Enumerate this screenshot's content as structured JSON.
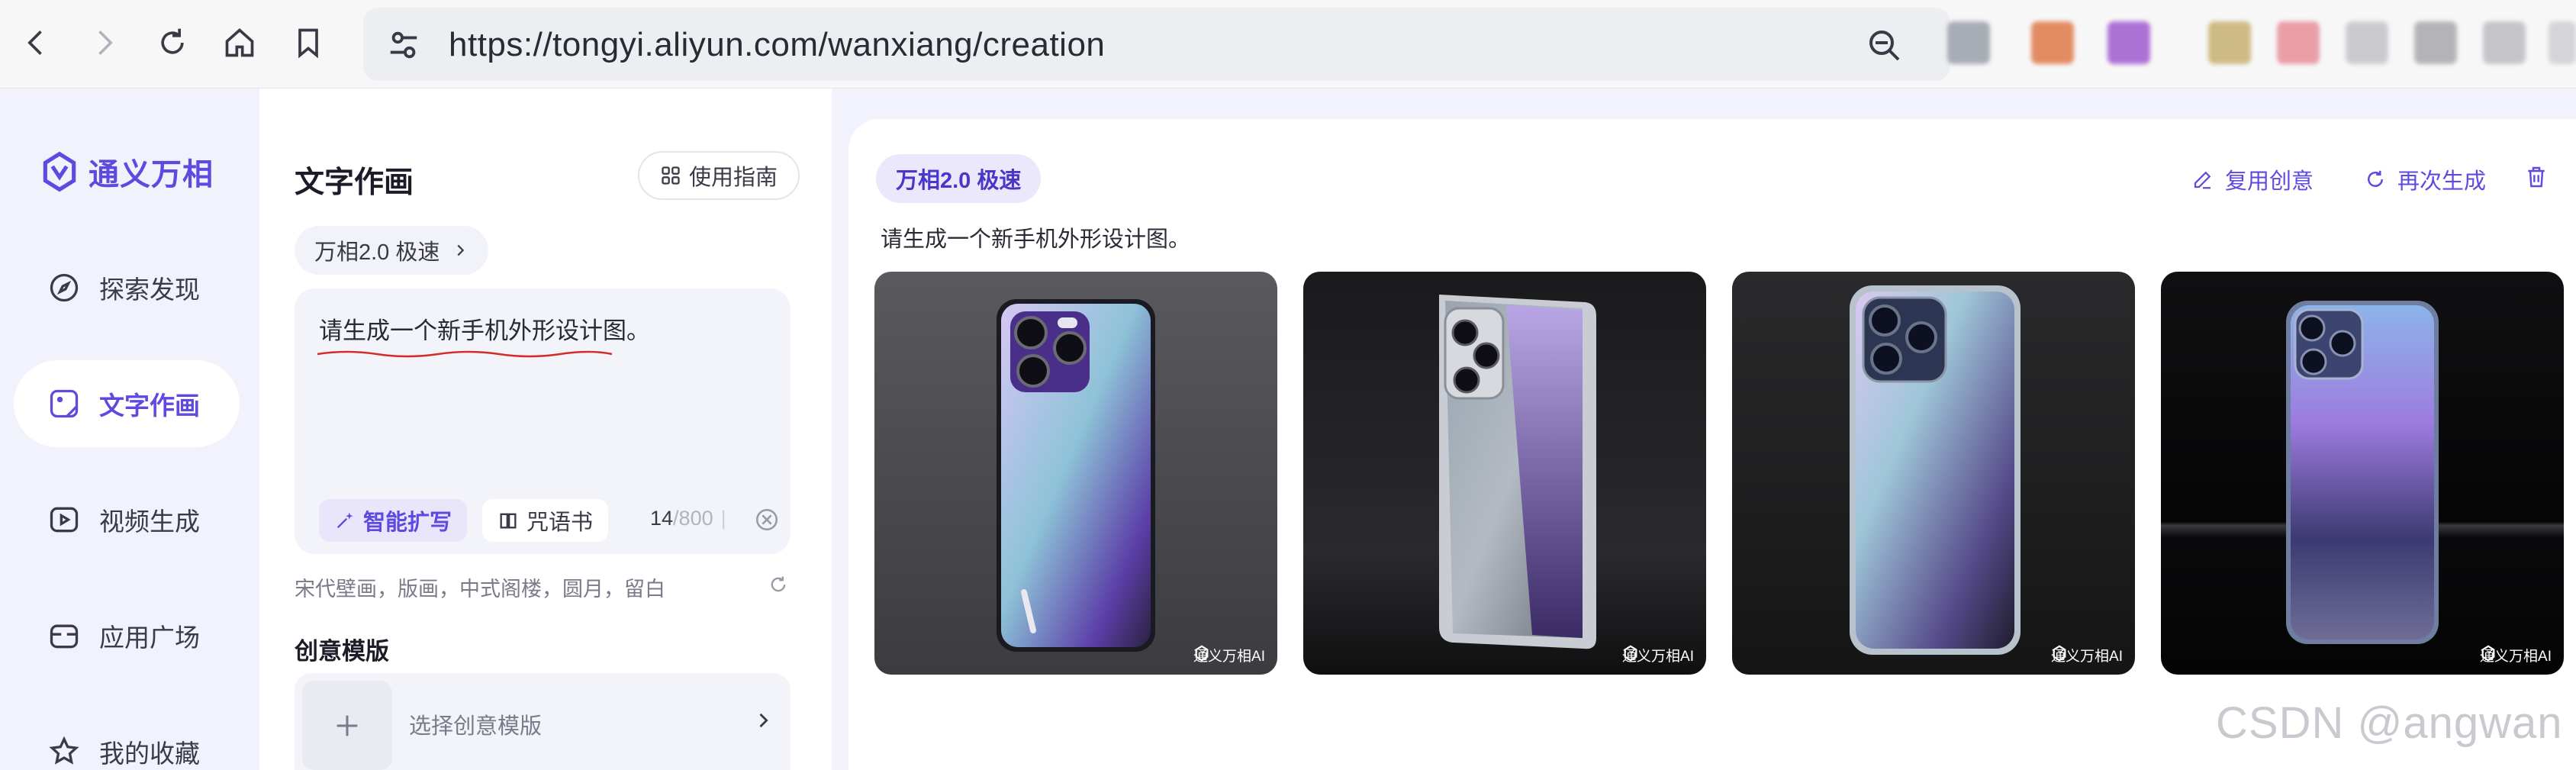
{
  "browser": {
    "url": "https://tongyi.aliyun.com/wanxiang/creation"
  },
  "sidebar": {
    "logo_text": "通义万相",
    "items": [
      {
        "label": "探索发现",
        "icon": "compass-icon"
      },
      {
        "label": "文字作画",
        "icon": "canvas-icon",
        "active": true
      },
      {
        "label": "视频生成",
        "icon": "video-icon"
      },
      {
        "label": "应用广场",
        "icon": "store-icon"
      },
      {
        "label": "我的收藏",
        "icon": "star-icon"
      }
    ]
  },
  "panel": {
    "title": "文字作画",
    "guide_label": "使用指南",
    "model_label": "万相2.0 极速",
    "prompt_text": "请生成一个新手机外形设计图。",
    "smart_expand_label": "智能扩写",
    "spellbook_label": "咒语书",
    "char_count": "14",
    "char_max": "/800",
    "suggestion_text": "宋代壁画，版画，中式阁楼，圆月，留白",
    "template_title": "创意模版",
    "template_placeholder": "选择创意模版"
  },
  "result": {
    "model_badge": "万相2.0 极速",
    "reuse_label": "复用创意",
    "regenerate_label": "再次生成",
    "prompt_text": "请生成一个新手机外形设计图。",
    "watermark": "通义万相AI",
    "images": [
      {
        "alt": "generated phone image 1"
      },
      {
        "alt": "generated phone image 2"
      },
      {
        "alt": "generated phone image 3"
      },
      {
        "alt": "generated phone image 4"
      }
    ]
  },
  "overlay_watermark": "CSDN @angwan",
  "colors": {
    "accent": "#5f4ae0",
    "sidebar_bg": "#f1f2fb"
  }
}
